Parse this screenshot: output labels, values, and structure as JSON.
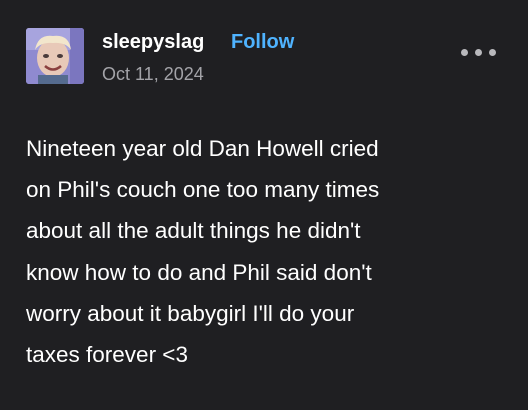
{
  "post": {
    "author": {
      "username": "sleepyslag",
      "follow_label": "Follow",
      "date": "Oct 11, 2024",
      "avatar_icon": "profile-avatar"
    },
    "menu_icon": "more-horizontal-icon",
    "body_lines": [
      "Nineteen year old Dan Howell cried",
      "on Phil's couch one too many times",
      "about all the adult things he didn't",
      "know how to do and Phil said don't",
      "worry about it babygirl I'll do your",
      "taxes forever <3"
    ]
  },
  "colors": {
    "background": "#1f1f22",
    "text": "#ffffff",
    "follow_accent": "#4fb3ff",
    "muted": "#a3a3a8"
  }
}
